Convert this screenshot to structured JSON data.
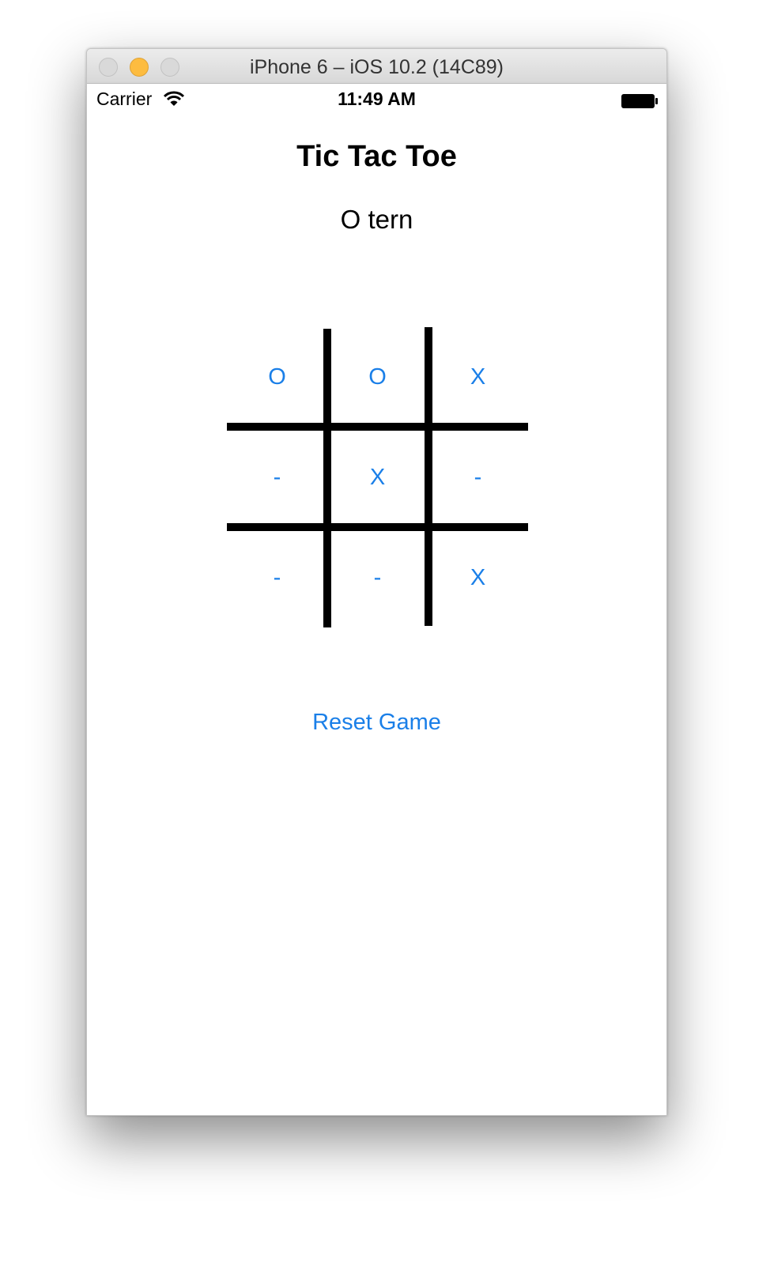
{
  "window": {
    "title": "iPhone 6 – iOS 10.2 (14C89)"
  },
  "status_bar": {
    "carrier": "Carrier",
    "time": "11:49 AM",
    "wifi_icon": "wifi-icon",
    "battery_icon": "battery-icon"
  },
  "app": {
    "title": "Tic Tac Toe",
    "turn_label": "O tern",
    "board": {
      "rows": [
        [
          "O",
          "O",
          "X"
        ],
        [
          "-",
          "X",
          "-"
        ],
        [
          "-",
          "-",
          "X"
        ]
      ]
    },
    "reset_label": "Reset Game"
  },
  "colors": {
    "accent": "#1a7fe8",
    "grid": "#000000",
    "traffic_minimize": "#fdbc40"
  }
}
